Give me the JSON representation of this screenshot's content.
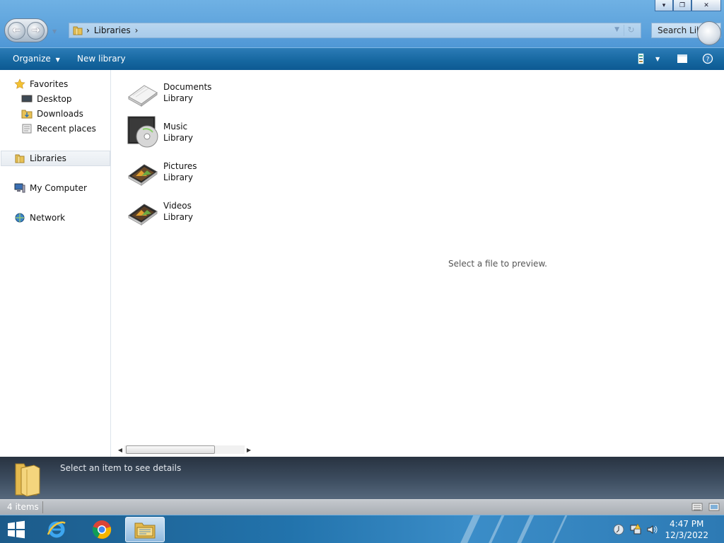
{
  "window": {
    "controls": {
      "minimize": "▾",
      "maximize": "❐",
      "close": "✕"
    }
  },
  "address": {
    "path": [
      "Libraries"
    ],
    "search_placeholder": "Search Libraries"
  },
  "toolbar": {
    "organize_label": "Organize",
    "new_library_label": "New library"
  },
  "nav": {
    "favorites": {
      "label": "Favorites",
      "items": [
        "Desktop",
        "Downloads",
        "Recent places"
      ]
    },
    "libraries": "Libraries",
    "computer": "My Computer",
    "network": "Network"
  },
  "libraries": [
    {
      "name": "Documents",
      "type": "Library",
      "icon": "documents-library-icon"
    },
    {
      "name": "Music",
      "type": "Library",
      "icon": "music-library-icon"
    },
    {
      "name": "Pictures",
      "type": "Library",
      "icon": "pictures-library-icon"
    },
    {
      "name": "Videos",
      "type": "Library",
      "icon": "videos-library-icon"
    }
  ],
  "preview": {
    "message": "Select a file to preview."
  },
  "details": {
    "message": "Select an item to see details"
  },
  "status": {
    "item_count": "4 items"
  },
  "taskbar": {
    "apps": [
      "internet-explorer-icon",
      "chrome-icon",
      "file-explorer-icon"
    ],
    "time": "4:47 PM",
    "date": "12/3/2022"
  },
  "colors": {
    "command_bar": "#15669f",
    "title_bar": "#5ea3dc",
    "details_pane": "#3d4d60",
    "taskbar": "#2273ac"
  }
}
